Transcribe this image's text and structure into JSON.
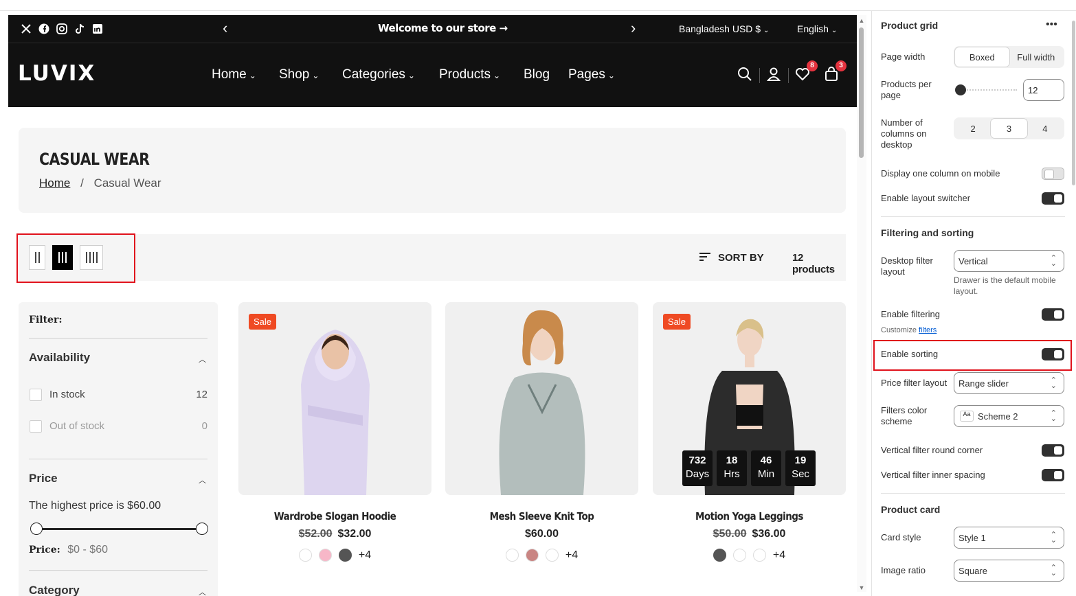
{
  "announcement": {
    "text": "Welcome to our store",
    "region": "Bangladesh USD $",
    "language": "English",
    "social_icons": [
      "x-icon",
      "facebook-icon",
      "instagram-icon",
      "tiktok-icon",
      "linkedin-icon"
    ]
  },
  "header": {
    "logo": "LUVIX",
    "nav": [
      "Home",
      "Shop",
      "Categories",
      "Products",
      "Blog",
      "Pages"
    ],
    "wishlist_count": "8",
    "cart_count": "3"
  },
  "hero": {
    "title": "CASUAL WEAR",
    "breadcrumb_home": "Home",
    "breadcrumb_sep": "/",
    "breadcrumb_current": "Casual Wear"
  },
  "toolbar": {
    "sort_label": "SORT BY",
    "count": "12 products"
  },
  "filter": {
    "title": "Filter:",
    "availability": "Availability",
    "in_stock": "In stock",
    "in_stock_count": "12",
    "out_of_stock": "Out of stock",
    "out_of_stock_count": "0",
    "price": "Price",
    "highest_price": "The highest price is $60.00",
    "price_label": "Price:",
    "price_range": "$0 - $60",
    "category": "Category"
  },
  "products": [
    {
      "name": "Wardrobe Slogan Hoodie",
      "old_price": "$52.00",
      "price": "$32.00",
      "sale": "Sale",
      "more": "+4",
      "swatches": [
        "#ffffff",
        "#f7b7c8",
        "#555555"
      ]
    },
    {
      "name": "Mesh Sleeve Knit Top",
      "old_price": "",
      "price": "$60.00",
      "sale": "",
      "more": "+4",
      "swatches": [
        "#ffffff",
        "#c98583",
        "#ffffff"
      ]
    },
    {
      "name": "Motion Yoga Leggings",
      "old_price": "$50.00",
      "price": "$36.00",
      "sale": "Sale",
      "more": "+4",
      "swatches": [
        "#555555",
        "#ffffff",
        "#ffffff"
      ]
    }
  ],
  "countdown": [
    {
      "value": "732",
      "unit": "Days"
    },
    {
      "value": "18",
      "unit": "Hrs"
    },
    {
      "value": "46",
      "unit": "Min"
    },
    {
      "value": "19",
      "unit": "Sec"
    }
  ],
  "panel": {
    "title": "Product grid",
    "page_width": "Page width",
    "boxed": "Boxed",
    "full_width": "Full width",
    "per_page": "Products per page",
    "per_page_value": "12",
    "columns": "Number of columns on desktop",
    "col_2": "2",
    "col_3": "3",
    "col_4": "4",
    "one_col_mobile": "Display one column on mobile",
    "layout_switcher": "Enable layout switcher",
    "filtering_sorting": "Filtering and sorting",
    "desktop_filter_layout": "Desktop filter layout",
    "desktop_filter_value": "Vertical",
    "drawer_note": "Drawer is the default mobile layout.",
    "enable_filtering": "Enable filtering",
    "customize": "Customize",
    "filters_link": "filters",
    "enable_sorting": "Enable sorting",
    "price_filter_layout": "Price filter layout",
    "price_filter_value": "Range slider",
    "filters_color_scheme": "Filters color scheme",
    "scheme_value": "Scheme 2",
    "scheme_swatch": "Aa",
    "round_corner": "Vertical filter round corner",
    "inner_spacing": "Vertical filter inner spacing",
    "product_card": "Product card",
    "card_style": "Card style",
    "card_style_value": "Style 1",
    "image_ratio": "Image ratio",
    "image_ratio_value": "Square"
  }
}
